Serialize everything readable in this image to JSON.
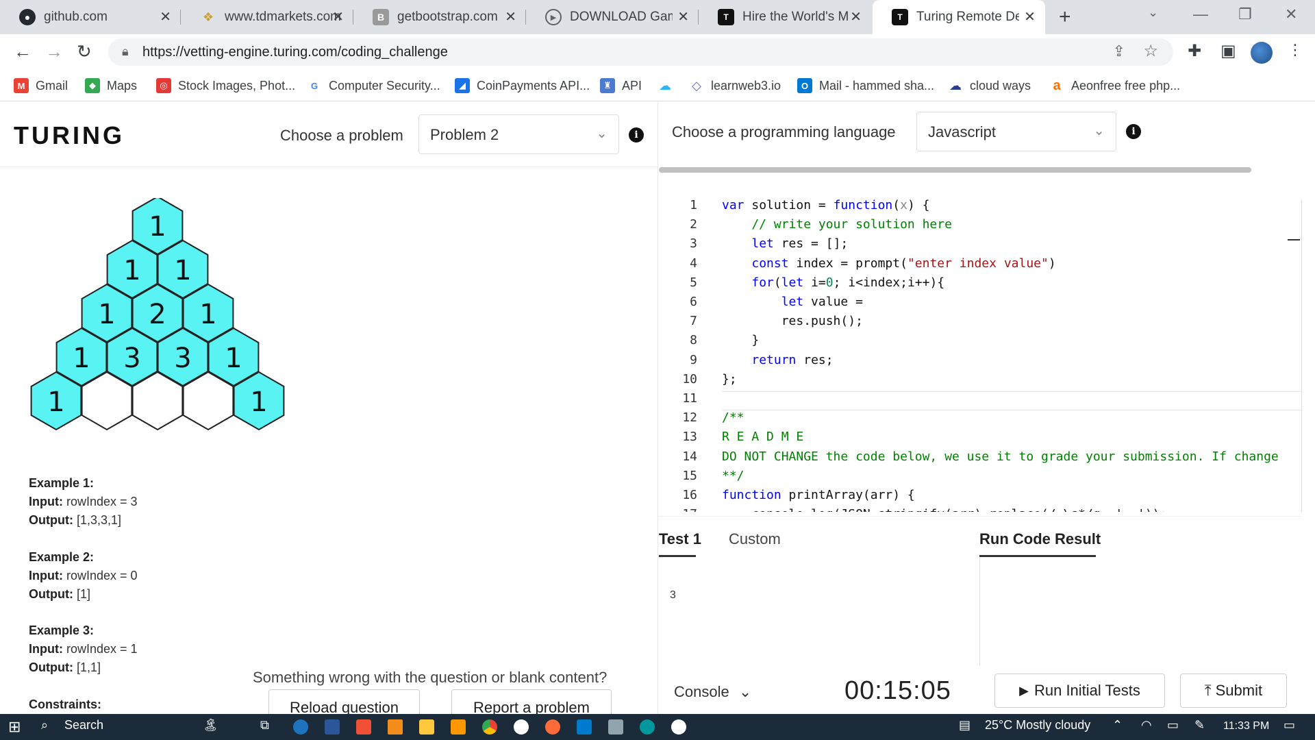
{
  "browser": {
    "tabs": [
      {
        "title": "github.com",
        "icon": "github-icon"
      },
      {
        "title": "www.tdmarkets.com",
        "icon": "tdmarkets-icon"
      },
      {
        "title": "getbootstrap.com",
        "icon": "bootstrap-icon"
      },
      {
        "title": "DOWNLOAD Game -",
        "icon": "download-icon"
      },
      {
        "title": "Hire the World's Mo",
        "icon": "turing-icon"
      },
      {
        "title": "Turing Remote Deve",
        "icon": "turing-icon"
      }
    ],
    "url": "https://vetting-engine.turing.com/coding_challenge",
    "bookmarks": [
      {
        "label": "Gmail",
        "color": "#ea4335",
        "glyph": "M"
      },
      {
        "label": "Maps",
        "color": "#34a853",
        "glyph": "◆"
      },
      {
        "label": "Stock Images, Phot...",
        "color": "#e53935",
        "glyph": "◎"
      },
      {
        "label": "Computer Security...",
        "color": "#4285f4",
        "glyph": "G"
      },
      {
        "label": "CoinPayments API...",
        "color": "#1a73e8",
        "glyph": "◢"
      },
      {
        "label": "API",
        "color": "#4a7bd0",
        "glyph": "♜"
      },
      {
        "label": "",
        "color": "#29b6f6",
        "glyph": "☁"
      },
      {
        "label": "learnweb3.io",
        "color": "#5c6bc0",
        "glyph": "◇"
      },
      {
        "label": "Mail - hammed sha...",
        "color": "#0078d4",
        "glyph": "O"
      },
      {
        "label": "cloud ways",
        "color": "#2c3e91",
        "glyph": "☁"
      },
      {
        "label": "Aeonfree free php...",
        "color": "#ff6f00",
        "glyph": "a"
      }
    ]
  },
  "header": {
    "logo": "TURING",
    "choose_problem_label": "Choose a problem",
    "problem_selected": "Problem 2",
    "choose_language_label": "Choose a programming language",
    "language_selected": "Javascript"
  },
  "pascal": {
    "rows": [
      [
        "1"
      ],
      [
        "1",
        "1"
      ],
      [
        "1",
        "2",
        "1"
      ],
      [
        "1",
        "3",
        "3",
        "1"
      ],
      [
        "1",
        "",
        "",
        "",
        "1"
      ]
    ],
    "fill_color": "#5af3f3",
    "empty_color": "#ffffff"
  },
  "examples": [
    {
      "title": "Example 1:",
      "input_label": "Input:",
      "input": " rowIndex = 3",
      "output_label": "Output:",
      "output": " [1,3,3,1]"
    },
    {
      "title": "Example 2:",
      "input_label": "Input:",
      "input": " rowIndex = 0",
      "output_label": "Output:",
      "output": " [1]"
    },
    {
      "title": "Example 3:",
      "input_label": "Input:",
      "input": " rowIndex = 1",
      "output_label": "Output:",
      "output": " [1,1]"
    }
  ],
  "constraints_label": "Constraints:",
  "report": {
    "question": "Something wrong with the question or blank content?",
    "reload": "Reload question",
    "report": "Report a problem"
  },
  "editor": {
    "lines": [
      {
        "n": "1",
        "code": "var solution = function(x) {"
      },
      {
        "n": "2",
        "code": "    // write your solution here"
      },
      {
        "n": "3",
        "code": "    let res = [];"
      },
      {
        "n": "4",
        "code": "    const index = prompt(\"enter index value\")"
      },
      {
        "n": "5",
        "code": "    for(let i=0; i<index;i++){"
      },
      {
        "n": "6",
        "code": "        let value = "
      },
      {
        "n": "7",
        "code": "        res.push();"
      },
      {
        "n": "8",
        "code": "    }"
      },
      {
        "n": "9",
        "code": "    return res;"
      },
      {
        "n": "10",
        "code": "};"
      },
      {
        "n": "11",
        "code": ""
      },
      {
        "n": "12",
        "code": "/**"
      },
      {
        "n": "13",
        "code": "R E A D M E"
      },
      {
        "n": "14",
        "code": "DO NOT CHANGE the code below, we use it to grade your submission. If change"
      },
      {
        "n": "15",
        "code": "**/"
      },
      {
        "n": "16",
        "code": "function printArray(arr) {"
      },
      {
        "n": "17",
        "code": "    console.log(JSON.stringify(arr).replace(/,\\s*/g, ', '));"
      }
    ]
  },
  "tests": {
    "tab_test1": "Test 1",
    "tab_custom": "Custom",
    "tab_result": "Run Code Result",
    "input_value": "3"
  },
  "bottom": {
    "console": "Console",
    "timer": "00:15:05",
    "run": "Run Initial Tests",
    "submit": "Submit"
  },
  "taskbar": {
    "search": "Search",
    "weather": "25°C  Mostly cloudy",
    "time": "11:33 PM"
  }
}
